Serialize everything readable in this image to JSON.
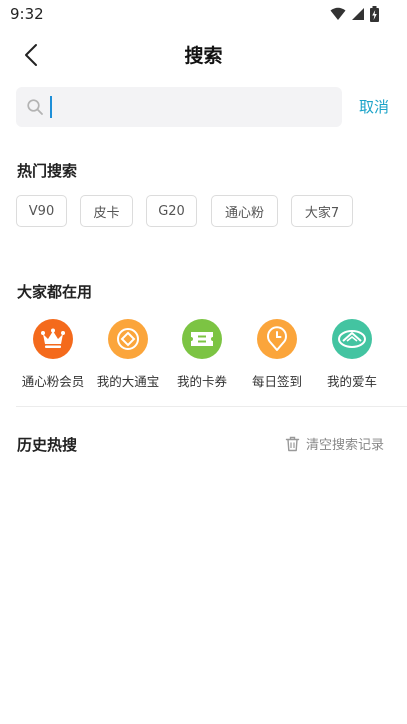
{
  "status_bar": {
    "time": "9:32"
  },
  "nav": {
    "title": "搜索"
  },
  "search": {
    "value": "",
    "placeholder": "",
    "cancel_label": "取消"
  },
  "hot_search": {
    "title": "热门搜索",
    "tags": [
      "V90",
      "皮卡",
      "G20",
      "通心粉",
      "大家7"
    ]
  },
  "popular_apps": {
    "title": "大家都在用",
    "items": [
      {
        "label": "通心粉会员",
        "icon": "crown-icon",
        "color": "#f46a1c"
      },
      {
        "label": "我的大通宝",
        "icon": "diamond-coin-icon",
        "color": "#fba53b"
      },
      {
        "label": "我的卡券",
        "icon": "ticket-icon",
        "color": "#7cc443"
      },
      {
        "label": "每日签到",
        "icon": "clock-pin-icon",
        "color": "#fba53b"
      },
      {
        "label": "我的爱车",
        "icon": "car-logo-icon",
        "color": "#43c4a1"
      }
    ]
  },
  "history": {
    "title": "历史热搜",
    "clear_label": "清空搜索记录"
  },
  "colors": {
    "accent": "#1aa3c8",
    "caret": "#1e8fd8"
  }
}
